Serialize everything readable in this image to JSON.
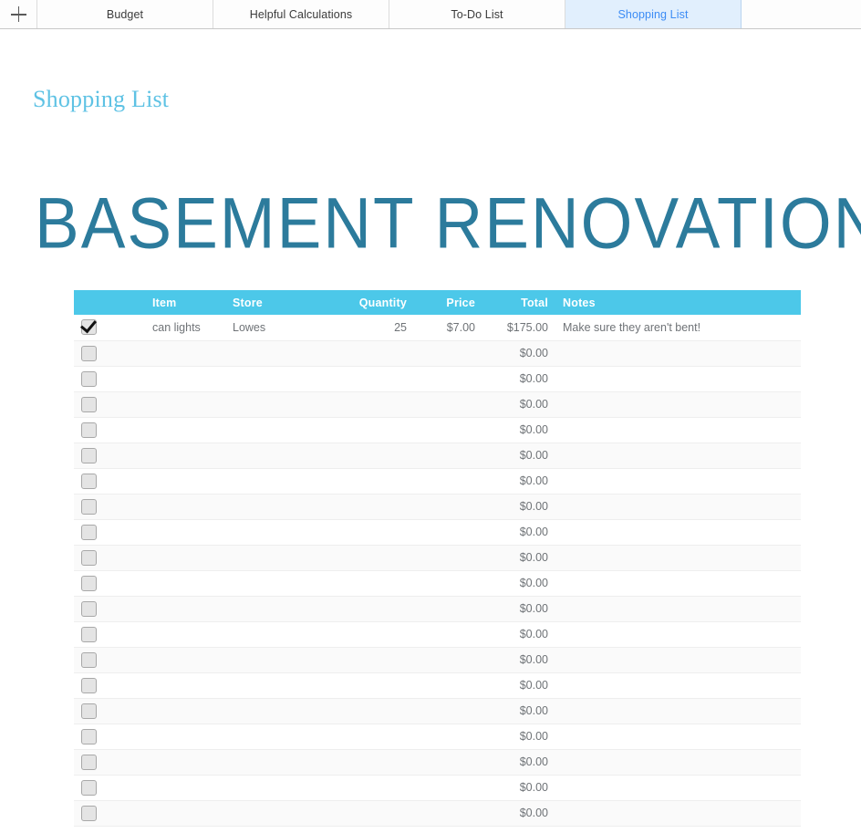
{
  "tabbar": {
    "add_icon": "plus-icon",
    "tabs": [
      {
        "label": "Budget",
        "active": false
      },
      {
        "label": "Helpful Calculations",
        "active": false
      },
      {
        "label": "To-Do List",
        "active": false
      },
      {
        "label": "Shopping List",
        "active": true
      }
    ]
  },
  "sheet": {
    "name": "Shopping List",
    "title": "BASEMENT RENOVATION"
  },
  "colors": {
    "header_cyan": "#4cc8e9",
    "sheet_name": "#5ec2e4",
    "doc_title": "#2c7b9c",
    "active_tab_bg": "#e1effd",
    "active_tab_text": "#3c8cf5"
  },
  "table": {
    "columns": [
      {
        "key": "check",
        "label": "",
        "align": "left"
      },
      {
        "key": "item",
        "label": "Item",
        "align": "left"
      },
      {
        "key": "store",
        "label": "Store",
        "align": "left"
      },
      {
        "key": "quantity",
        "label": "Quantity",
        "align": "right"
      },
      {
        "key": "price",
        "label": "Price",
        "align": "right"
      },
      {
        "key": "total",
        "label": "Total",
        "align": "right"
      },
      {
        "key": "notes",
        "label": "Notes",
        "align": "left"
      }
    ],
    "rows": [
      {
        "checked": true,
        "item": "can lights",
        "store": "Lowes",
        "quantity": "25",
        "price": "$7.00",
        "total": "$175.00",
        "notes": "Make sure they aren't bent!"
      },
      {
        "checked": false,
        "item": "",
        "store": "",
        "quantity": "",
        "price": "",
        "total": "$0.00",
        "notes": ""
      },
      {
        "checked": false,
        "item": "",
        "store": "",
        "quantity": "",
        "price": "",
        "total": "$0.00",
        "notes": ""
      },
      {
        "checked": false,
        "item": "",
        "store": "",
        "quantity": "",
        "price": "",
        "total": "$0.00",
        "notes": ""
      },
      {
        "checked": false,
        "item": "",
        "store": "",
        "quantity": "",
        "price": "",
        "total": "$0.00",
        "notes": ""
      },
      {
        "checked": false,
        "item": "",
        "store": "",
        "quantity": "",
        "price": "",
        "total": "$0.00",
        "notes": ""
      },
      {
        "checked": false,
        "item": "",
        "store": "",
        "quantity": "",
        "price": "",
        "total": "$0.00",
        "notes": ""
      },
      {
        "checked": false,
        "item": "",
        "store": "",
        "quantity": "",
        "price": "",
        "total": "$0.00",
        "notes": ""
      },
      {
        "checked": false,
        "item": "",
        "store": "",
        "quantity": "",
        "price": "",
        "total": "$0.00",
        "notes": ""
      },
      {
        "checked": false,
        "item": "",
        "store": "",
        "quantity": "",
        "price": "",
        "total": "$0.00",
        "notes": ""
      },
      {
        "checked": false,
        "item": "",
        "store": "",
        "quantity": "",
        "price": "",
        "total": "$0.00",
        "notes": ""
      },
      {
        "checked": false,
        "item": "",
        "store": "",
        "quantity": "",
        "price": "",
        "total": "$0.00",
        "notes": ""
      },
      {
        "checked": false,
        "item": "",
        "store": "",
        "quantity": "",
        "price": "",
        "total": "$0.00",
        "notes": ""
      },
      {
        "checked": false,
        "item": "",
        "store": "",
        "quantity": "",
        "price": "",
        "total": "$0.00",
        "notes": ""
      },
      {
        "checked": false,
        "item": "",
        "store": "",
        "quantity": "",
        "price": "",
        "total": "$0.00",
        "notes": ""
      },
      {
        "checked": false,
        "item": "",
        "store": "",
        "quantity": "",
        "price": "",
        "total": "$0.00",
        "notes": ""
      },
      {
        "checked": false,
        "item": "",
        "store": "",
        "quantity": "",
        "price": "",
        "total": "$0.00",
        "notes": ""
      },
      {
        "checked": false,
        "item": "",
        "store": "",
        "quantity": "",
        "price": "",
        "total": "$0.00",
        "notes": ""
      },
      {
        "checked": false,
        "item": "",
        "store": "",
        "quantity": "",
        "price": "",
        "total": "$0.00",
        "notes": ""
      },
      {
        "checked": false,
        "item": "",
        "store": "",
        "quantity": "",
        "price": "",
        "total": "$0.00",
        "notes": ""
      }
    ]
  }
}
